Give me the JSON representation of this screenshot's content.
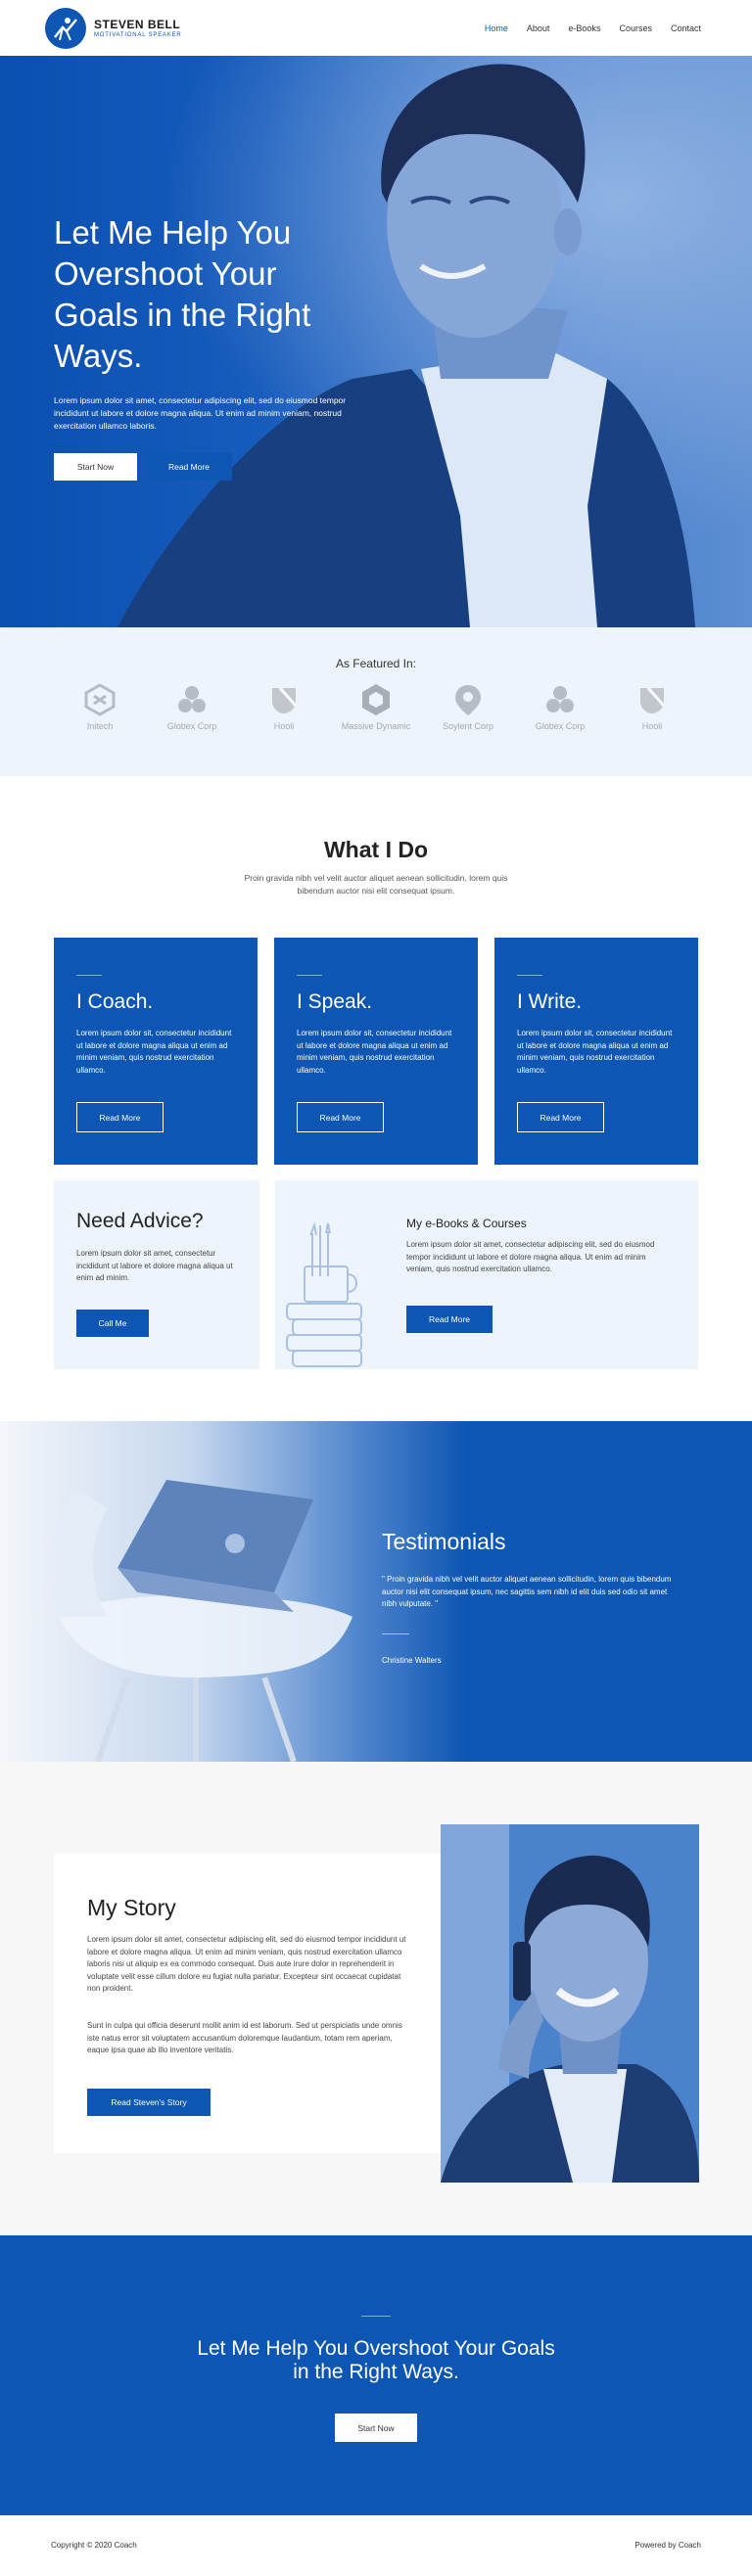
{
  "brand": {
    "name": "STEVEN BELL",
    "tagline": "MOTIVATIONAL SPEAKER",
    "accent": "#0d56b3"
  },
  "nav": {
    "items": [
      "Home",
      "About",
      "e-Books",
      "Courses",
      "Contact"
    ],
    "active": "Home"
  },
  "hero": {
    "title_lines": [
      "Let Me Help You",
      "Overshoot Your",
      "Goals in the Right",
      "Ways."
    ],
    "body": "Lorem ipsum dolor sit amet, consectetur adipiscing elit, sed do eiusmod tempor incididunt ut labore et dolore magna aliqua. Ut enim ad minim veniam, nostrud exercitation ullamco laboris.",
    "primary_button": "Start Now",
    "secondary_button": "Read More"
  },
  "featured": {
    "title": "As Featured In:",
    "logos": [
      "Initech",
      "Globex Corp",
      "Hooli",
      "Massive Dynamic",
      "Soylent Corp",
      "Globex Corp",
      "Hooli"
    ]
  },
  "what_i_do": {
    "title": "What I Do",
    "subtitle": "Proin gravida nibh vel velit auctor aliquet aenean sollicitudin, lorem quis bibendum auctor nisi elit consequat ipsum.",
    "services": [
      {
        "title": "I Coach.",
        "text": "Lorem ipsum dolor sit, consectetur incididunt ut labore et dolore magna aliqua ut enim ad minim veniam, quis nostrud exercitation ullamco.",
        "button": "Read More"
      },
      {
        "title": "I Speak.",
        "text": "Lorem ipsum dolor sit, consectetur incididunt ut labore et dolore magna aliqua ut enim ad minim veniam, quis nostrud exercitation ullamco.",
        "button": "Read More"
      },
      {
        "title": "I Write.",
        "text": "Lorem ipsum dolor sit, consectetur incididunt ut labore et dolore magna aliqua ut enim ad minim veniam, quis nostrud exercitation ullamco.",
        "button": "Read More"
      }
    ],
    "advice": {
      "title": "Need Advice?",
      "text": "Lorem ipsum dolor sit amet, consectetur incididunt ut labore et dolore magna aliqua ut enim ad minim.",
      "button": "Call Me"
    },
    "ebooks": {
      "title": "My e-Books & Courses",
      "text": "Lorem ipsum dolor sit amet, consectetur adipiscing elit, sed do eiusmod tempor incididunt ut labore et dolore magna aliqua. Ut enim ad minim veniam, quis nostrud exercitation ullamco.",
      "button": "Read More"
    }
  },
  "testimonials": {
    "title": "Testimonials",
    "quote": "\" Proin gravida nibh vel velit auctor aliquet aenean sollicitudin, lorem quis bibendum auctor nisi elit consequat ipsum, nec sagittis sem nibh id elit duis sed odio sit amet nibh vulputate. \"",
    "author": "Christine Walters"
  },
  "story": {
    "title": "My Story",
    "paragraph1": "Lorem ipsum dolor sit amet, consectetur adipiscing elit, sed do eiusmod tempor incididunt ut labore et dolore magna aliqua. Ut enim ad minim veniam, quis nostrud exercitation ullamco laboris nisi ut aliquip ex ea commodo consequat. Duis aute irure dolor in reprehenderit in voluptate velit esse cillum dolore eu fugiat nulla pariatur. Excepteur sint occaecat cupidatat non proident.",
    "paragraph2": "Sunt in culpa qui officia deserunt mollit anim id est laborum. Sed ut perspiciatis unde omnis iste natus error sit voluptatem accusantium doloremque laudantium, totam rem aperiam, eaque ipsa quae ab illo inventore veritatis.",
    "button": "Read Steven's Story"
  },
  "cta": {
    "title_lines": [
      "Let Me Help You Overshoot Your Goals",
      "in the Right Ways."
    ],
    "button": "Start Now"
  },
  "footer": {
    "copyright": "Copyright © 2020 Coach",
    "powered": "Powered by Coach"
  }
}
